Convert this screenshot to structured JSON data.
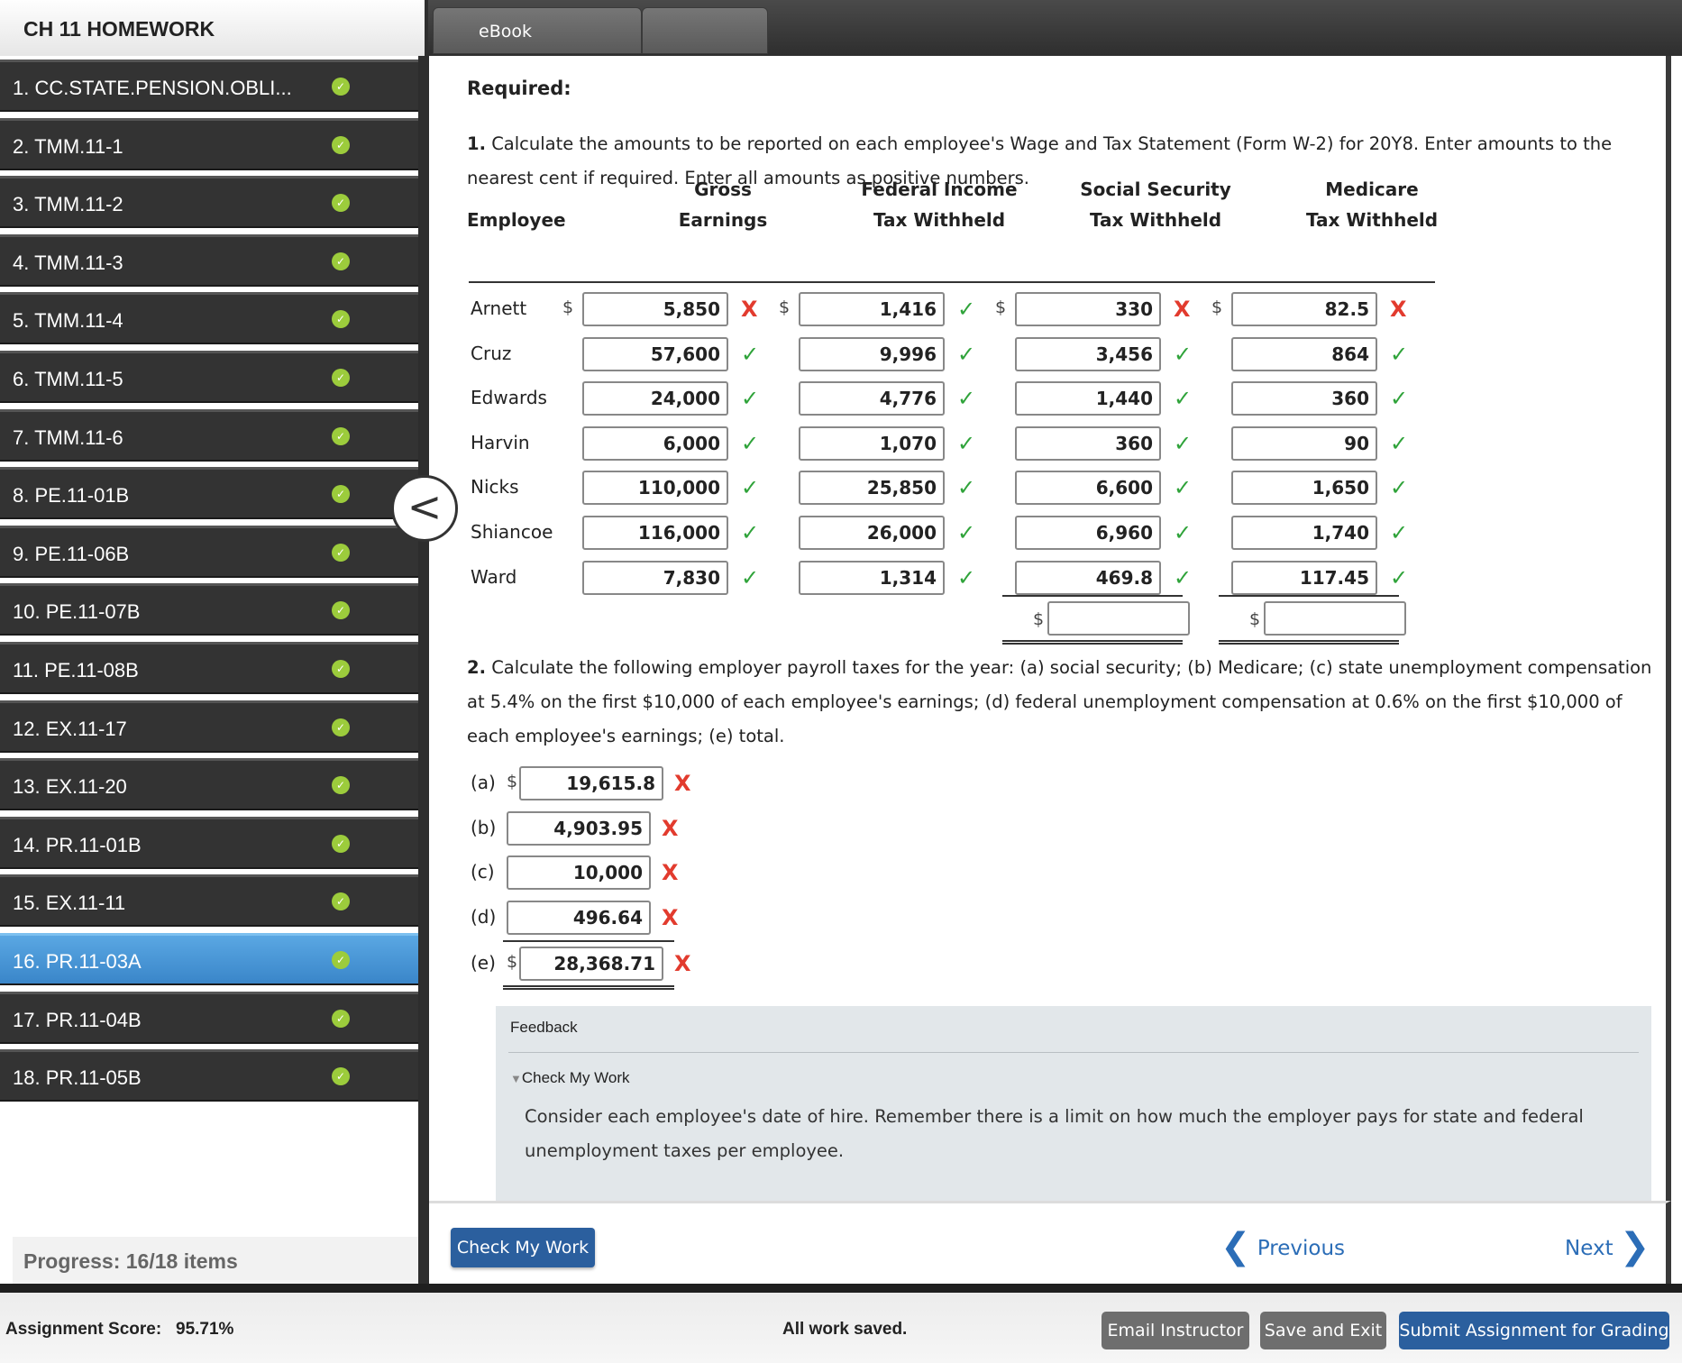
{
  "header": {
    "assignment_title": "CH 11 HOMEWORK",
    "tabs": [
      "eBook",
      ""
    ]
  },
  "sidebar": {
    "items": [
      {
        "label": "1. CC.STATE.PENSION.OBLI...",
        "done": true
      },
      {
        "label": "2. TMM.11-1",
        "done": true
      },
      {
        "label": "3. TMM.11-2",
        "done": true
      },
      {
        "label": "4. TMM.11-3",
        "done": true
      },
      {
        "label": "5. TMM.11-4",
        "done": true
      },
      {
        "label": "6. TMM.11-5",
        "done": true
      },
      {
        "label": "7. TMM.11-6",
        "done": true
      },
      {
        "label": "8. PE.11-01B",
        "done": true
      },
      {
        "label": "9. PE.11-06B",
        "done": true
      },
      {
        "label": "10. PE.11-07B",
        "done": true
      },
      {
        "label": "11. PE.11-08B",
        "done": true
      },
      {
        "label": "12. EX.11-17",
        "done": true
      },
      {
        "label": "13. EX.11-20",
        "done": true
      },
      {
        "label": "14. PR.11-01B",
        "done": true
      },
      {
        "label": "15. EX.11-11",
        "done": true
      },
      {
        "label": "16. PR.11-03A",
        "done": true,
        "active": true
      },
      {
        "label": "17. PR.11-04B",
        "done": true
      },
      {
        "label": "18. PR.11-05B",
        "done": true
      }
    ],
    "progress_label": "Progress:",
    "progress_value": "16/18 items",
    "collapse_glyph": "<"
  },
  "content": {
    "required": "Required:",
    "q1_num": "1.",
    "q1_text": "Calculate the amounts to be reported on each employee's Wage and Tax Statement (Form W-2) for 20Y8. Enter amounts to the nearest cent if required. Enter all amounts as positive numbers.",
    "table": {
      "headers": {
        "employee": "Employee",
        "gross_1": "Gross",
        "gross_2": "Earnings",
        "fed_1": "Federal Income",
        "fed_2": "Tax Withheld",
        "ss_1": "Social Security",
        "ss_2": "Tax Withheld",
        "med_1": "Medicare",
        "med_2": "Tax Withheld"
      },
      "currency": "$",
      "rows": [
        {
          "employee": "Arnett",
          "gross": "5,850",
          "gross_ok": false,
          "fed": "1,416",
          "fed_ok": true,
          "ss": "330",
          "ss_ok": false,
          "med": "82.5",
          "med_ok": false
        },
        {
          "employee": "Cruz",
          "gross": "57,600",
          "gross_ok": true,
          "fed": "9,996",
          "fed_ok": true,
          "ss": "3,456",
          "ss_ok": true,
          "med": "864",
          "med_ok": true
        },
        {
          "employee": "Edwards",
          "gross": "24,000",
          "gross_ok": true,
          "fed": "4,776",
          "fed_ok": true,
          "ss": "1,440",
          "ss_ok": true,
          "med": "360",
          "med_ok": true
        },
        {
          "employee": "Harvin",
          "gross": "6,000",
          "gross_ok": true,
          "fed": "1,070",
          "fed_ok": true,
          "ss": "360",
          "ss_ok": true,
          "med": "90",
          "med_ok": true
        },
        {
          "employee": "Nicks",
          "gross": "110,000",
          "gross_ok": true,
          "fed": "25,850",
          "fed_ok": true,
          "ss": "6,600",
          "ss_ok": true,
          "med": "1,650",
          "med_ok": true
        },
        {
          "employee": "Shiancoe",
          "gross": "116,000",
          "gross_ok": true,
          "fed": "26,000",
          "fed_ok": true,
          "ss": "6,960",
          "ss_ok": true,
          "med": "1,740",
          "med_ok": true
        },
        {
          "employee": "Ward",
          "gross": "7,830",
          "gross_ok": true,
          "fed": "1,314",
          "fed_ok": true,
          "ss": "469.8",
          "ss_ok": true,
          "med": "117.45",
          "med_ok": true
        }
      ],
      "total_ss": "",
      "total_med": ""
    },
    "q2_num": "2.",
    "q2_text": "Calculate the following employer payroll taxes for the year: (a) social security; (b) Medicare; (c) state unemployment compensation at 5.4% on the first $10,000 of each employee's earnings; (d) federal unemployment compensation at 0.6% on the first $10,000 of each employee's earnings; (e) total.",
    "part2": [
      {
        "label": "(a)",
        "dollar": true,
        "value": "19,615.8",
        "ok": false
      },
      {
        "label": "(b)",
        "dollar": false,
        "value": "4,903.95",
        "ok": false
      },
      {
        "label": "(c)",
        "dollar": false,
        "value": "10,000",
        "ok": false
      },
      {
        "label": "(d)",
        "dollar": false,
        "value": "496.64",
        "ok": false
      },
      {
        "label": "(e)",
        "dollar": true,
        "value": "28,368.71",
        "ok": false
      }
    ],
    "feedback": {
      "title": "Feedback",
      "toggle": "Check My Work",
      "text": "Consider each employee's date of hire. Remember there is a limit on how much the employer pays for state and federal unemployment taxes per employee."
    },
    "marks": {
      "ok": "✓",
      "bad": "X"
    }
  },
  "footer": {
    "check_my_work": "Check My Work",
    "previous": "Previous",
    "next": "Next",
    "prev_glyph": "❮",
    "next_glyph": "❯"
  },
  "statusbar": {
    "score_label": "Assignment Score:",
    "score_value": "95.71%",
    "saved": "All work saved.",
    "email": "Email Instructor",
    "save_exit": "Save and Exit",
    "submit": "Submit Assignment for Grading"
  },
  "colors": {
    "ok": "#2fa33a",
    "bad": "#e23b2e",
    "accent": "#2b5f9e",
    "active_nav": "#4a97d8"
  }
}
